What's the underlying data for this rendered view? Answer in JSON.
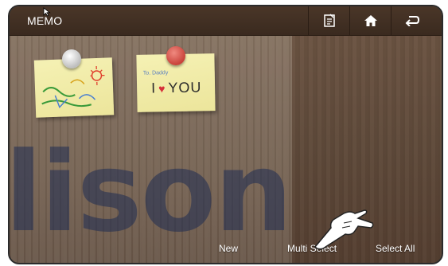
{
  "app": {
    "title": "MEMO"
  },
  "toolbar": {
    "icons": [
      "memo-list-icon",
      "home-icon",
      "back-icon"
    ]
  },
  "memos": [
    {
      "pin_color": "#c9423a",
      "drawing": "doodle"
    },
    {
      "to_text": "To. Daddy",
      "message_left": "I",
      "message_right": "YOU",
      "pin_color": "#c9423a"
    }
  ],
  "watermark": {
    "text": "lison"
  },
  "bottom": {
    "new_label": "New",
    "multi_select_label": "Multi Select",
    "select_all_label": "Select All"
  }
}
